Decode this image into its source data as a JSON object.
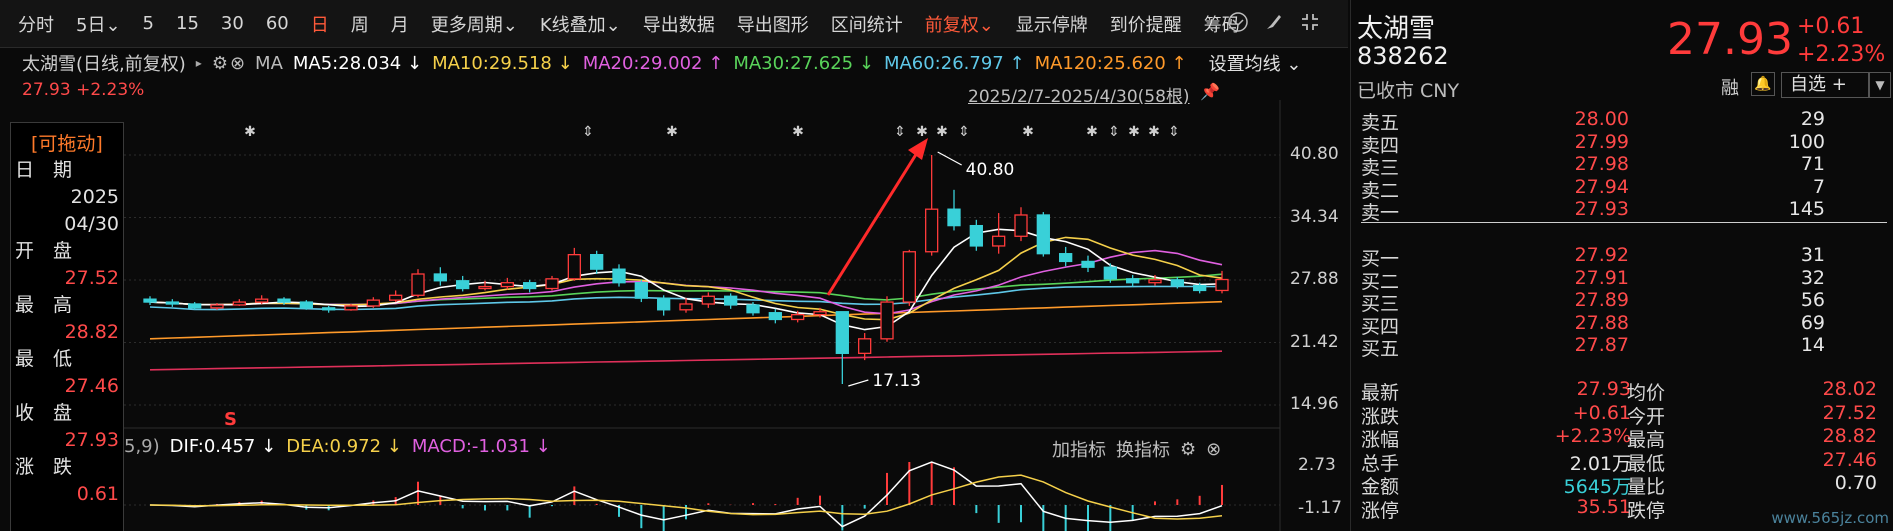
{
  "toolbar": {
    "items": [
      "分时",
      "5日",
      "5",
      "15",
      "30",
      "60",
      "日",
      "周",
      "月",
      "更多周期",
      "K线叠加",
      "导出数据",
      "导出图形",
      "区间统计",
      "前复权",
      "显示停牌",
      "到价提醒",
      "筹码"
    ],
    "active": [
      "日",
      "前复权"
    ],
    "dropdowns": [
      "5日",
      "更多周期",
      "K线叠加",
      "前复权"
    ]
  },
  "ma_line": {
    "name": "太湖雪(日线,前复权)",
    "ma_label": "MA",
    "ma5": "MA5:28.034",
    "ma5_arrow": "↓",
    "ma10": "MA10:29.518",
    "ma10_arrow": "↓",
    "ma20": "MA20:29.002",
    "ma20_arrow": "↑",
    "ma30": "MA30:27.625",
    "ma30_arrow": "↓",
    "ma60": "MA60:26.797",
    "ma60_arrow": "↑",
    "ma120": "MA120:25.620",
    "ma120_arrow": "↑",
    "settings": "设置均线"
  },
  "sub_price": "27.93  +2.23%",
  "range": "2025/2/7-2025/4/30(58根)",
  "drag_panel": {
    "title": "[可拖动]",
    "date_label": "日　期",
    "year": "2025",
    "date": "04/30",
    "open_label": "开　盘",
    "open": "27.52",
    "high_label": "最　高",
    "high": "28.82",
    "low_label": "最　低",
    "low": "27.46",
    "close_label": "收　盘",
    "close": "27.93",
    "chg_label": "涨　跌",
    "chg": "0.61"
  },
  "y_axis": [
    "40.80",
    "34.34",
    "27.88",
    "21.42",
    "14.96"
  ],
  "macd_axis": [
    "2.73",
    "-1.17"
  ],
  "annotations": {
    "high": "40.80",
    "low": "17.13",
    "marker": "S"
  },
  "macd": {
    "params": "5,9)",
    "dif": "DIF:0.457",
    "dif_arrow": "↓",
    "dea": "DEA:0.972",
    "dea_arrow": "↓",
    "macd": "MACD:-1.031",
    "macd_arrow": "↓",
    "add_indicator": "加指标",
    "switch_indicator": "换指标"
  },
  "quote": {
    "name": "太湖雪",
    "code": "838262",
    "status": "已收市 CNY",
    "price": "27.93",
    "change": "+0.61",
    "change_pct": "+2.23%",
    "rong": "融",
    "watchlist": "自选 +"
  },
  "order_book": {
    "asks": [
      {
        "label": "卖五",
        "price": "28.00",
        "vol": "29"
      },
      {
        "label": "卖四",
        "price": "27.99",
        "vol": "100"
      },
      {
        "label": "卖三",
        "price": "27.98",
        "vol": "71"
      },
      {
        "label": "卖二",
        "price": "27.94",
        "vol": "7"
      },
      {
        "label": "卖一",
        "price": "27.93",
        "vol": "145"
      }
    ],
    "bids": [
      {
        "label": "买一",
        "price": "27.92",
        "vol": "31"
      },
      {
        "label": "买二",
        "price": "27.91",
        "vol": "32"
      },
      {
        "label": "买三",
        "price": "27.89",
        "vol": "56"
      },
      {
        "label": "买四",
        "price": "27.88",
        "vol": "69"
      },
      {
        "label": "买五",
        "price": "27.87",
        "vol": "14"
      }
    ]
  },
  "stats": [
    {
      "l1": "最新",
      "v1": "27.93",
      "c1": "red",
      "l2": "均价",
      "v2": "28.02",
      "c2": "red"
    },
    {
      "l1": "涨跌",
      "v1": "+0.61",
      "c1": "red",
      "l2": "今开",
      "v2": "27.52",
      "c2": "red"
    },
    {
      "l1": "涨幅",
      "v1": "+2.23%",
      "c1": "red",
      "l2": "最高",
      "v2": "28.82",
      "c2": "red"
    },
    {
      "l1": "总手",
      "v1": "2.01万",
      "c1": "white",
      "l2": "最低",
      "v2": "27.46",
      "c2": "red"
    },
    {
      "l1": "金额",
      "v1": "5645万",
      "c1": "cyan",
      "l2": "量比",
      "v2": "0.70",
      "c2": "white"
    },
    {
      "l1": "涨停",
      "v1": "35.51",
      "c1": "red",
      "l2": "跌停",
      "v2": "",
      "c2": "white"
    }
  ],
  "watermark": "www.565jz.com",
  "colors": {
    "up": "#ff3b3b",
    "down": "#39d0d8",
    "ma5": "#ffffff",
    "ma10": "#f5d04a",
    "ma20": "#e060e0",
    "ma30": "#59d35a",
    "ma60": "#5fc8e8",
    "ma120": "#ff9a2a",
    "ma250": "#e0305a"
  },
  "chart_data": {
    "type": "candlestick",
    "ylim": [
      14.96,
      40.8
    ],
    "y_ticks": [
      40.8,
      34.34,
      27.88,
      21.42,
      14.96
    ],
    "candles": [
      [
        25.9,
        25.6,
        26.2,
        25.3
      ],
      [
        25.6,
        25.4,
        25.9,
        25.1
      ],
      [
        25.4,
        25.0,
        25.6,
        24.8
      ],
      [
        25.0,
        25.3,
        25.5,
        24.8
      ],
      [
        25.3,
        25.6,
        25.9,
        25.2
      ],
      [
        25.6,
        25.9,
        26.3,
        25.4
      ],
      [
        25.9,
        25.6,
        26.1,
        25.3
      ],
      [
        25.6,
        25.0,
        25.8,
        24.8
      ],
      [
        25.0,
        24.8,
        25.2,
        24.5
      ],
      [
        24.8,
        25.2,
        25.4,
        24.7
      ],
      [
        25.2,
        25.8,
        26.1,
        25.0
      ],
      [
        25.8,
        26.3,
        26.8,
        25.6
      ],
      [
        26.3,
        28.5,
        29.0,
        26.1
      ],
      [
        28.5,
        27.8,
        29.2,
        27.3
      ],
      [
        27.8,
        27.0,
        28.3,
        26.7
      ],
      [
        27.0,
        27.2,
        27.8,
        26.8
      ],
      [
        27.2,
        27.6,
        28.1,
        26.9
      ],
      [
        27.6,
        27.0,
        27.9,
        26.6
      ],
      [
        27.0,
        28.0,
        28.3,
        26.8
      ],
      [
        28.0,
        30.5,
        31.2,
        27.8
      ],
      [
        30.5,
        29.0,
        30.9,
        28.5
      ],
      [
        29.0,
        27.6,
        29.5,
        27.2
      ],
      [
        27.6,
        26.0,
        27.9,
        25.6
      ],
      [
        26.0,
        24.8,
        26.3,
        24.2
      ],
      [
        24.8,
        25.4,
        26.0,
        24.5
      ],
      [
        25.4,
        26.2,
        26.6,
        25.0
      ],
      [
        26.2,
        25.3,
        26.5,
        24.9
      ],
      [
        25.3,
        24.5,
        25.6,
        24.2
      ],
      [
        24.5,
        23.8,
        24.9,
        23.4
      ],
      [
        23.8,
        24.3,
        24.7,
        23.5
      ],
      [
        24.3,
        24.6,
        25.0,
        24.0
      ],
      [
        24.6,
        20.3,
        24.6,
        17.13
      ],
      [
        20.3,
        21.8,
        22.4,
        19.6
      ],
      [
        21.8,
        25.6,
        26.2,
        21.5
      ],
      [
        25.6,
        30.8,
        31.0,
        25.2
      ],
      [
        30.8,
        35.2,
        40.8,
        30.4
      ],
      [
        35.2,
        33.5,
        37.2,
        33.0
      ],
      [
        33.5,
        31.4,
        34.1,
        30.9
      ],
      [
        31.4,
        32.4,
        34.8,
        30.6
      ],
      [
        32.4,
        34.6,
        35.4,
        31.9
      ],
      [
        34.6,
        30.6,
        34.9,
        30.3
      ],
      [
        30.6,
        29.8,
        31.3,
        29.3
      ],
      [
        29.8,
        29.2,
        30.4,
        28.7
      ],
      [
        29.2,
        28.0,
        29.6,
        27.6
      ],
      [
        28.0,
        27.6,
        28.4,
        27.2
      ],
      [
        27.6,
        27.9,
        28.4,
        27.3
      ],
      [
        27.9,
        27.3,
        28.2,
        27.0
      ],
      [
        27.3,
        26.8,
        27.6,
        26.5
      ],
      [
        26.8,
        27.93,
        28.82,
        26.5
      ]
    ],
    "candle_format": [
      "open",
      "close",
      "high",
      "low"
    ]
  }
}
